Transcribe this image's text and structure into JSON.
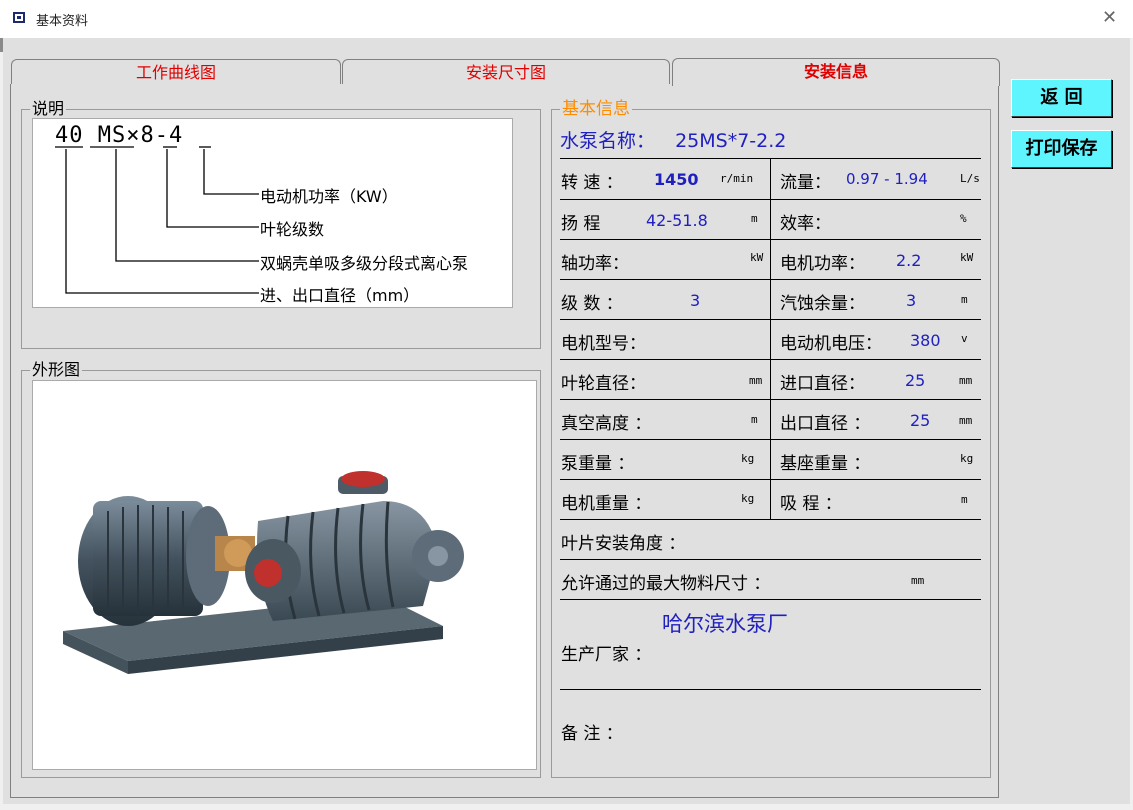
{
  "window": {
    "title": "基本资料",
    "close_symbol": "✕"
  },
  "tabs": [
    {
      "label": "工作曲线图"
    },
    {
      "label": "安装尺寸图"
    },
    {
      "label": "安装信息"
    }
  ],
  "description_group": {
    "label": "说明",
    "model_parts": [
      "40",
      "MS",
      "×",
      "8",
      "-",
      "4"
    ],
    "legend": [
      "电动机功率（KW）",
      "叶轮级数",
      "双蜗壳单吸多级分段式离心泵",
      "进、出口直径（mm）"
    ]
  },
  "shape_group": {
    "label": "外形图",
    "image_icon": "pump-photo"
  },
  "basic_info": {
    "group_label": "基本信息",
    "pump_name_label": "水泵名称：",
    "pump_name_value": "25MS*7-2.2",
    "speed_label": "转 速 ：",
    "speed_value": "1450",
    "speed_unit": "r/min",
    "flow_label": "流量：",
    "flow_value": "0.97 - 1.94",
    "flow_unit": "L/s",
    "head_label": "扬 程",
    "head_value": "42-51.8",
    "head_unit": "m",
    "efficiency_label": "效率：",
    "efficiency_value": "",
    "efficiency_unit": "%",
    "shaft_power_label": "轴功率：",
    "shaft_power_value": "",
    "shaft_power_unit": "kW",
    "motor_power_label": "电机功率：",
    "motor_power_value": "2.2",
    "motor_power_unit": "kW",
    "stages_label": "级 数 ：",
    "stages_value": "3",
    "npsh_label": "汽蚀余量：",
    "npsh_value": "3",
    "npsh_unit": "m",
    "motor_model_label": "电机型号：",
    "motor_model_value": "",
    "motor_voltage_label": "电动机电压：",
    "motor_voltage_value": "380",
    "motor_voltage_unit": "v",
    "impeller_dia_label": "叶轮直径：",
    "impeller_dia_unit": "mm",
    "inlet_dia_label": "进口直径：",
    "inlet_dia_value": "25",
    "inlet_dia_unit": "mm",
    "vacuum_label": "真空高度 ：",
    "vacuum_unit": "m",
    "outlet_dia_label": "出口直径 ：",
    "outlet_dia_value": "25",
    "outlet_dia_unit": "mm",
    "pump_weight_label": "泵重量 ：",
    "pump_weight_unit": "kg",
    "base_weight_label": "基座重量 ：",
    "base_weight_unit": "kg",
    "motor_weight_label": "电机重量 ：",
    "motor_weight_unit": "kg",
    "suction_label": "吸 程 ：",
    "suction_unit": "m",
    "blade_angle_label": "叶片安装角度 ：",
    "max_particle_label": "允许通过的最大物料尺寸 ：",
    "max_particle_unit": "mm",
    "manufacturer_value": "哈尔滨水泵厂",
    "manufacturer_label": "生产厂家 ：",
    "remark_label": "备  注 ："
  },
  "buttons": {
    "back": "返  回",
    "print_save": "打印保存"
  },
  "colors": {
    "tab_text": "#e00000",
    "value_text": "#2020c0",
    "button_bg": "#5ff5ff",
    "group_title": "#ff8c00"
  }
}
